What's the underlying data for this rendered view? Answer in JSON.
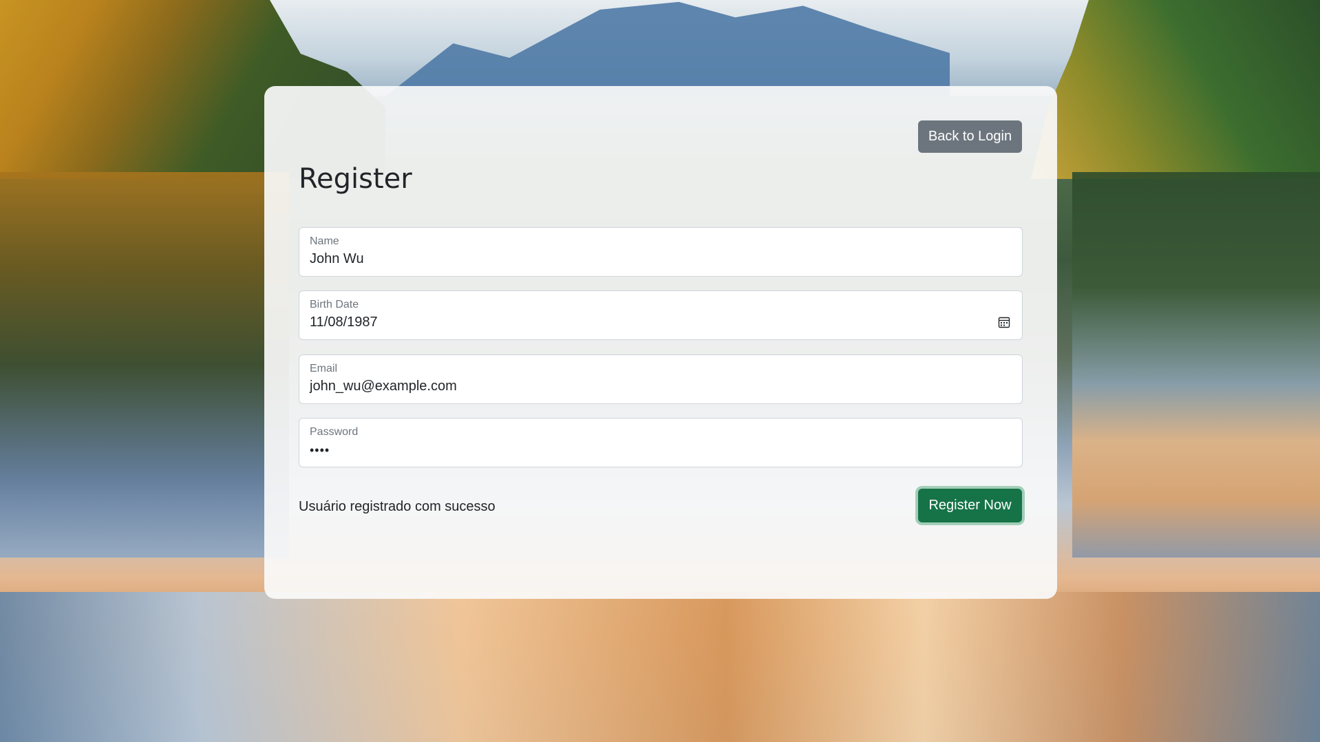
{
  "header": {
    "back_label": "Back to Login",
    "title": "Register"
  },
  "form": {
    "name": {
      "label": "Name",
      "value": "John Wu"
    },
    "birth_date": {
      "label": "Birth Date",
      "value": "11/08/1987"
    },
    "email": {
      "label": "Email",
      "value": "john_wu@example.com"
    },
    "password": {
      "label": "Password",
      "value": "••••"
    }
  },
  "footer": {
    "status_message": "Usuário registrado com sucesso",
    "register_label": "Register Now"
  },
  "icons": {
    "calendar": "calendar-icon"
  },
  "colors": {
    "back_button": "#6c757d",
    "register_button": "#157347",
    "card_background": "#fafafa"
  }
}
